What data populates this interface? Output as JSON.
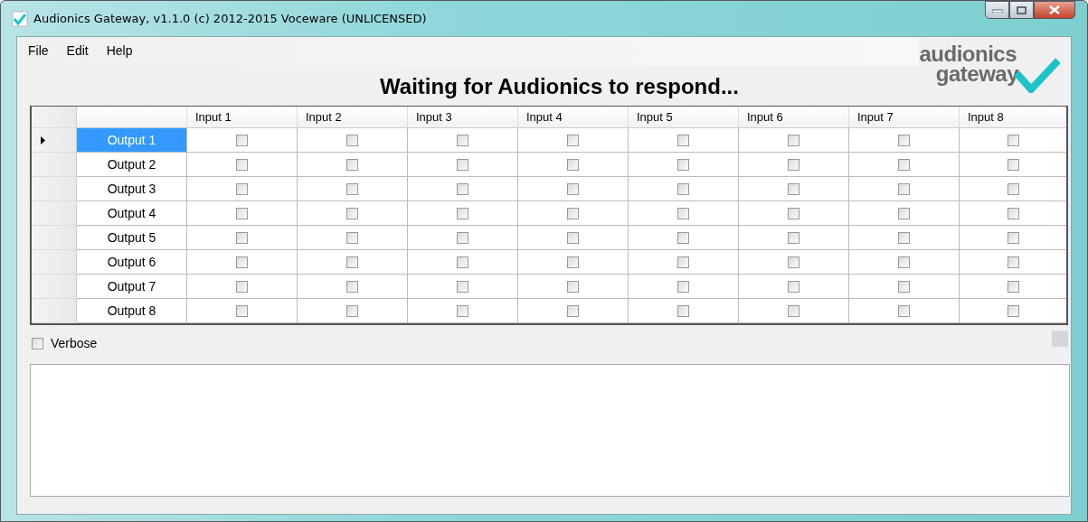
{
  "window": {
    "title": "Audionics Gateway, v1.1.0 (c) 2012-2015 Voceware (UNLICENSED)"
  },
  "menu": [
    "File",
    "Edit",
    "Help"
  ],
  "heading": "Waiting for Audionics to respond...",
  "logo": {
    "line_1": "audionics",
    "line_2": "gateway"
  },
  "grid": {
    "columns": [
      "Input 1",
      "Input 2",
      "Input 3",
      "Input 4",
      "Input 5",
      "Input 6",
      "Input 7",
      "Input 8"
    ],
    "rows": [
      {
        "label": "Output 1",
        "selected": true,
        "cells": [
          {
            "checked": false
          },
          {
            "checked": false
          },
          {
            "checked": false
          },
          {
            "checked": false
          },
          {
            "checked": false
          },
          {
            "checked": false
          },
          {
            "checked": false
          },
          {
            "checked": false
          }
        ]
      },
      {
        "label": "Output 2",
        "selected": false,
        "cells": [
          {
            "checked": false
          },
          {
            "checked": false
          },
          {
            "checked": false
          },
          {
            "checked": false
          },
          {
            "checked": false
          },
          {
            "checked": false
          },
          {
            "checked": false
          },
          {
            "checked": false
          }
        ]
      },
      {
        "label": "Output 3",
        "selected": false,
        "cells": [
          {
            "checked": false
          },
          {
            "checked": false
          },
          {
            "checked": false
          },
          {
            "checked": false
          },
          {
            "checked": false
          },
          {
            "checked": false
          },
          {
            "checked": false
          },
          {
            "checked": false
          }
        ]
      },
      {
        "label": "Output 4",
        "selected": false,
        "cells": [
          {
            "checked": false
          },
          {
            "checked": false
          },
          {
            "checked": false
          },
          {
            "checked": false
          },
          {
            "checked": false
          },
          {
            "checked": false
          },
          {
            "checked": false
          },
          {
            "checked": false
          }
        ]
      },
      {
        "label": "Output 5",
        "selected": false,
        "cells": [
          {
            "checked": false
          },
          {
            "checked": false
          },
          {
            "checked": false
          },
          {
            "checked": false
          },
          {
            "checked": false
          },
          {
            "checked": false
          },
          {
            "checked": false
          },
          {
            "checked": false
          }
        ]
      },
      {
        "label": "Output 6",
        "selected": false,
        "cells": [
          {
            "checked": false
          },
          {
            "checked": false
          },
          {
            "checked": false
          },
          {
            "checked": false
          },
          {
            "checked": false
          },
          {
            "checked": false
          },
          {
            "checked": false
          },
          {
            "checked": false
          }
        ]
      },
      {
        "label": "Output 7",
        "selected": false,
        "cells": [
          {
            "checked": false
          },
          {
            "checked": false
          },
          {
            "checked": false
          },
          {
            "checked": false
          },
          {
            "checked": false
          },
          {
            "checked": false
          },
          {
            "checked": false
          },
          {
            "checked": false
          }
        ]
      },
      {
        "label": "Output 8",
        "selected": false,
        "cells": [
          {
            "checked": false
          },
          {
            "checked": false
          },
          {
            "checked": false
          },
          {
            "checked": false
          },
          {
            "checked": false
          },
          {
            "checked": false
          },
          {
            "checked": false
          },
          {
            "checked": false
          }
        ]
      }
    ]
  },
  "verbose": {
    "label": "Verbose",
    "checked": false
  }
}
